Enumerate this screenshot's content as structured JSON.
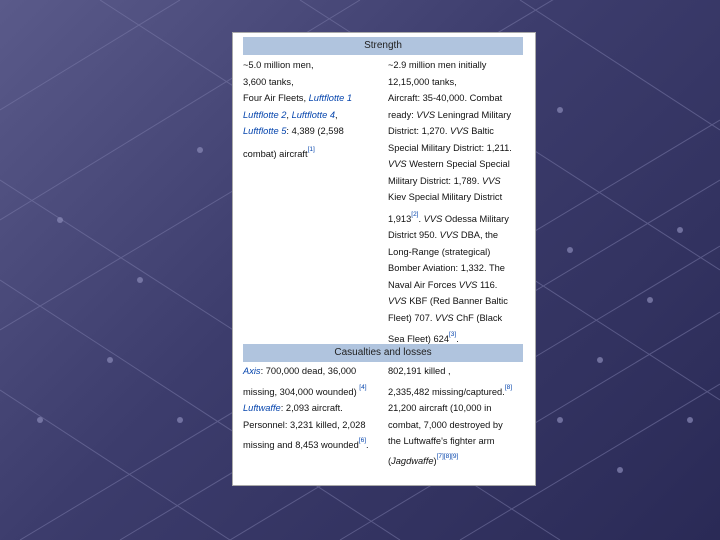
{
  "strength": {
    "header": "Strength",
    "left_lines": [
      "~5.0 million men,",
      "3,600 tanks,",
      "Four Air Fleets,",
      "Luftflotte 1",
      "Luftflotte 2",
      "Luftflotte 4",
      "Luftflotte 5",
      ": 4,389 (2,598",
      "combat) aircraft",
      "[1]"
    ],
    "right": {
      "l1": "~2.9 million men initially",
      "l2": "12,15,000 tanks,",
      "l3": "Aircraft: 35-40,000. Combat",
      "l4a": "ready: ",
      "l4b": "VVS",
      "l4c": " Leningrad Military",
      "l5": "District: 1,270. ",
      "l5b": "VVS",
      "l5c": " Baltic",
      "l6": "Special Military District: 1,211.",
      "l7a": "VVS",
      "l7b": " Western Special Special",
      "l8a": "Military District: 1,789. ",
      "l8b": "VVS",
      "l9": "Kiev Special Military District",
      "l10a": "1,913",
      "l10sup": "[2]",
      "l10b": ". ",
      "l10c": "VVS",
      "l10d": " Odessa Military",
      "l11a": "District 950. ",
      "l11b": "VVS",
      "l11c": " DBA, the",
      "l12": "Long-Range (strategical)",
      "l13": "Bomber Aviation: 1,332. The",
      "l14a": "Naval Air Forces ",
      "l14b": "VVS",
      "l14c": " 116.",
      "l15a": "VVS",
      "l15b": " KBF (Red Banner Baltic",
      "l16a": "Fleet) 707. ",
      "l16b": "VVS",
      "l16c": " ChF (Black",
      "l17a": "Sea Fleet) 624",
      "l17sup": "[3]",
      "l17b": "."
    }
  },
  "casualties": {
    "header": "Casualties and losses",
    "left": {
      "l1a": "Axis",
      "l1b": ": 700,000 dead, 36,000",
      "l2a": "missing, 304,000 wounded) ",
      "l2sup": "[4]",
      "l3a": "Luftwaffe",
      "l3b": ": 2,093 aircraft.",
      "l4": "Personnel: 3,231 killed, 2,028",
      "l5a": "missing and 8,453 wounded",
      "l5sup": "[6]",
      "l5b": "."
    },
    "right": {
      "l1": "802,191 killed ,",
      "l2a": "2,335,482 missing/captured.",
      "l2sup": "[8]",
      "l3": "21,200 aircraft (10,000 in",
      "l4": "combat, 7,000 destroyed by",
      "l5": "the Luftwaffe's fighter arm",
      "l6a": "(",
      "l6b": "Jagdwaffe",
      "l6c": ")",
      "l6sup": "[7][8][9]"
    }
  }
}
